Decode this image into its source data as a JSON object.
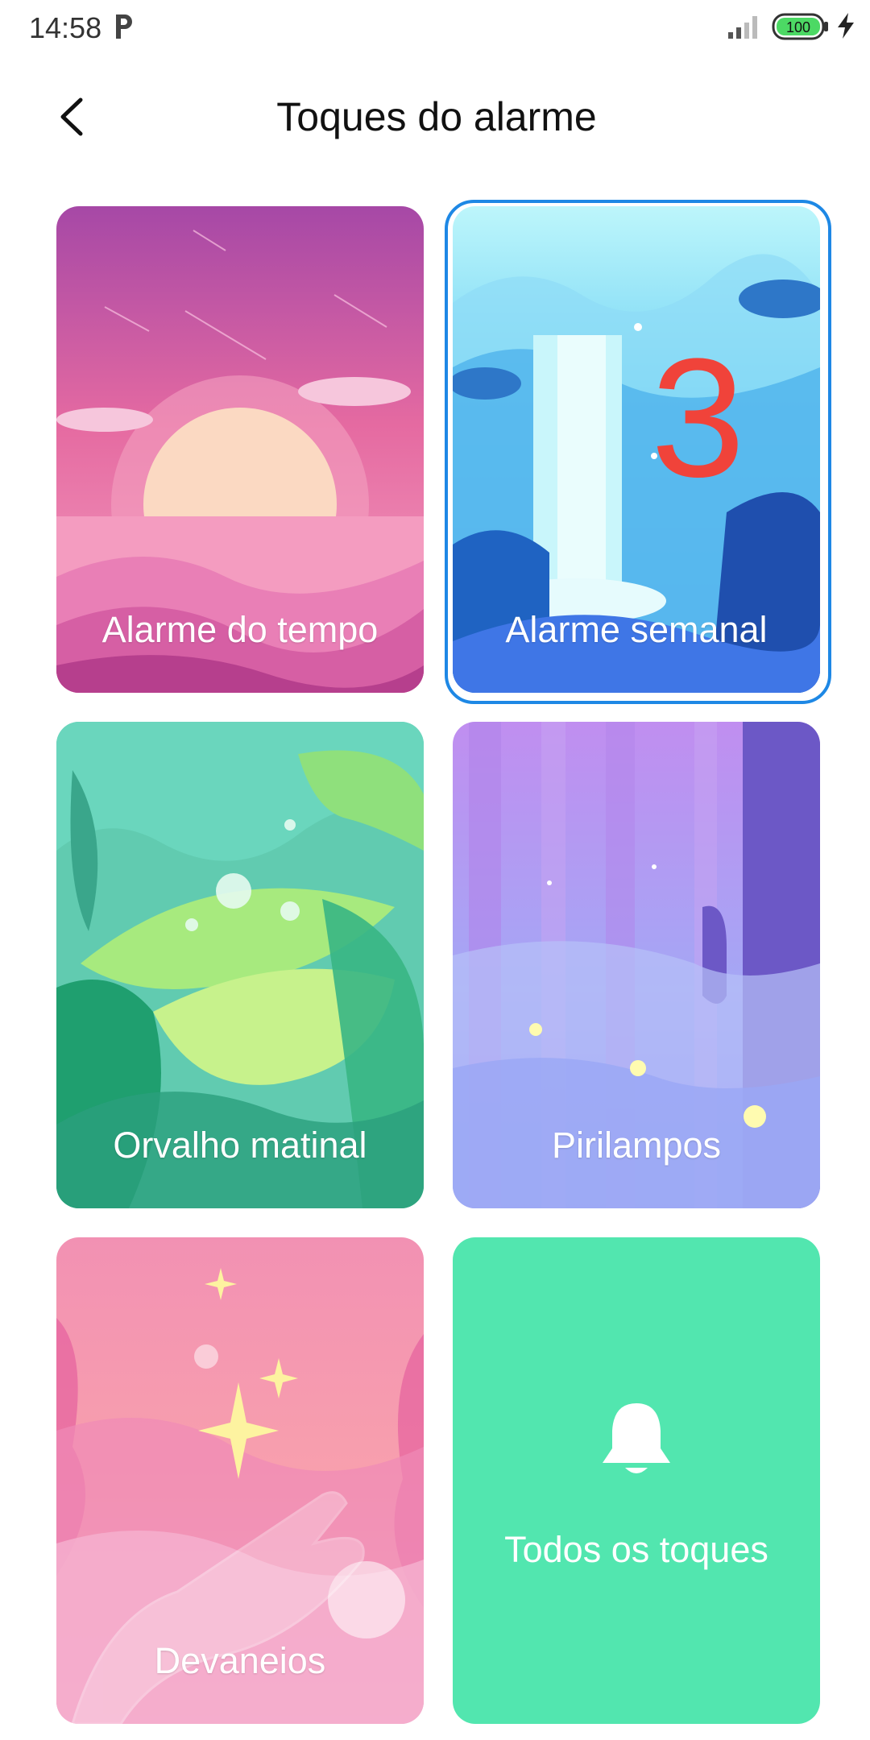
{
  "status_bar": {
    "time": "14:58",
    "notification_icon": "p-icon",
    "signal_icon": "signal-icon",
    "battery_level": "100",
    "charging_icon": "bolt-icon"
  },
  "header": {
    "back_icon": "chevron-left-icon",
    "title": "Toques do alarme"
  },
  "ringtones": [
    {
      "label": "Alarme do tempo",
      "selected": false
    },
    {
      "label": "Alarme semanal",
      "selected": true,
      "badge": "3"
    },
    {
      "label": "Orvalho matinal",
      "selected": false
    },
    {
      "label": "Pirilampos",
      "selected": false
    },
    {
      "label": "Devaneios",
      "selected": false
    }
  ],
  "all_ringtones": {
    "label": "Todos os toques",
    "icon": "bell-icon",
    "color": "#52e6af"
  },
  "colors": {
    "accent": "#1e88e5",
    "badge": "#f0433a"
  }
}
